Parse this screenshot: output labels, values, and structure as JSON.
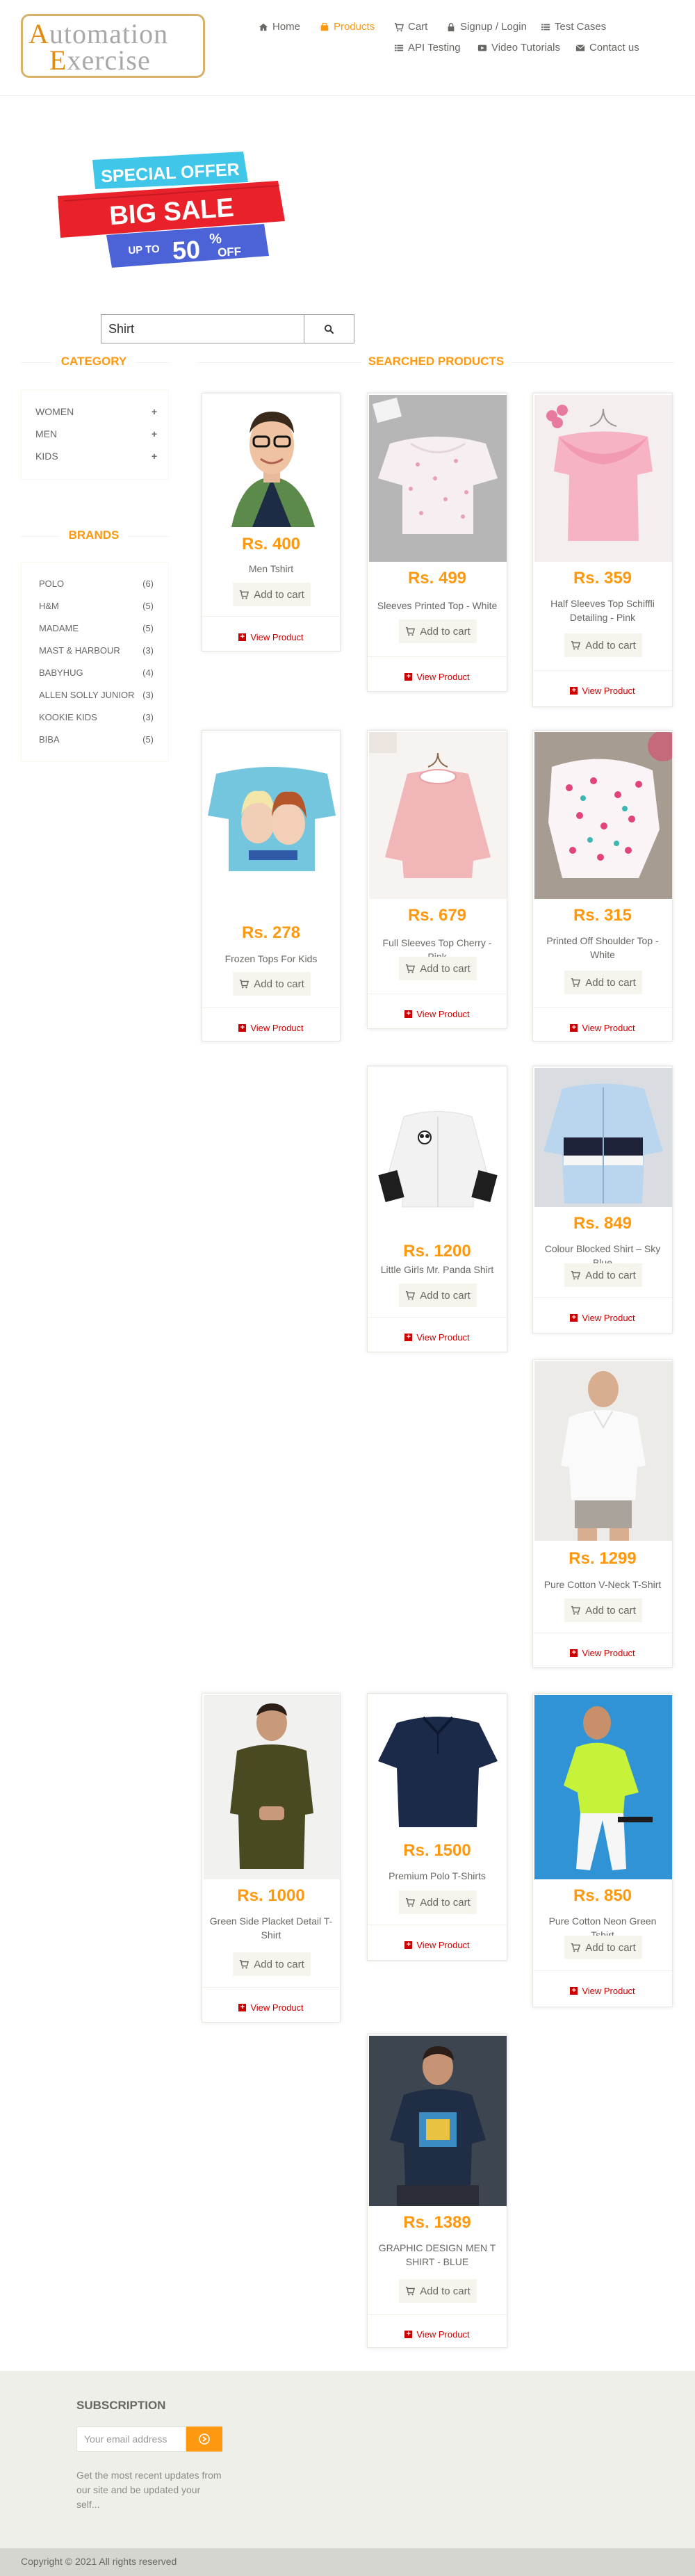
{
  "logo": {
    "line1_cap": "A",
    "line1_rest": "utomation",
    "line2_cap": "E",
    "line2_rest": "xercise"
  },
  "nav": [
    {
      "label": "Home",
      "icon": "home-icon"
    },
    {
      "label": "Products",
      "icon": "products-icon",
      "active": true
    },
    {
      "label": "Cart",
      "icon": "cart-icon"
    },
    {
      "label": "Signup / Login",
      "icon": "lock-icon"
    },
    {
      "label": "Test Cases",
      "icon": "list-icon"
    },
    {
      "label": "API Testing",
      "icon": "list-icon"
    },
    {
      "label": "Video Tutorials",
      "icon": "youtube-icon"
    },
    {
      "label": "Contact us",
      "icon": "envelope-icon"
    }
  ],
  "banner": {
    "special": "SPECIAL OFFER",
    "big_sale": "BIG SALE",
    "up_to": "UP TO",
    "percent": "50",
    "percent_sign": "%",
    "off": "OFF"
  },
  "search": {
    "value": "Shirt"
  },
  "category": {
    "title": "CATEGORY",
    "items": [
      {
        "label": "WOMEN"
      },
      {
        "label": "MEN"
      },
      {
        "label": "KIDS"
      }
    ]
  },
  "brands": {
    "title": "BRANDS",
    "items": [
      {
        "name": "POLO",
        "count": "(6)"
      },
      {
        "name": "H&M",
        "count": "(5)"
      },
      {
        "name": "MADAME",
        "count": "(5)"
      },
      {
        "name": "MAST & HARBOUR",
        "count": "(3)"
      },
      {
        "name": "BABYHUG",
        "count": "(4)"
      },
      {
        "name": "ALLEN SOLLY JUNIOR",
        "count": "(3)"
      },
      {
        "name": "KOOKIE KIDS",
        "count": "(3)"
      },
      {
        "name": "BIBA",
        "count": "(5)"
      }
    ]
  },
  "products": {
    "title": "SEARCHED PRODUCTS",
    "add_to_cart": "Add to cart",
    "view_product": "View Product",
    "items": [
      {
        "price": "Rs. 400",
        "name": "Men Tshirt"
      },
      {
        "price": "Rs. 499",
        "name": "Sleeves Printed Top - White"
      },
      {
        "price": "Rs. 359",
        "name": "Half Sleeves Top Schiffli Detailing - Pink"
      },
      {
        "price": "Rs. 278",
        "name": "Frozen Tops For Kids"
      },
      {
        "price": "Rs. 679",
        "name": "Full Sleeves Top Cherry - Pink"
      },
      {
        "price": "Rs. 315",
        "name": "Printed Off Shoulder Top - White"
      },
      {
        "price": "Rs. 1200",
        "name": "Little Girls Mr. Panda Shirt"
      },
      {
        "price": "Rs. 849",
        "name": "Colour Blocked Shirt – Sky Blue"
      },
      {
        "price": "Rs. 1299",
        "name": "Pure Cotton V-Neck T-Shirt"
      },
      {
        "price": "Rs. 1000",
        "name": "Green Side Placket Detail T-Shirt"
      },
      {
        "price": "Rs. 1500",
        "name": "Premium Polo T-Shirts"
      },
      {
        "price": "Rs. 850",
        "name": "Pure Cotton Neon Green Tshirt"
      },
      {
        "price": "Rs. 1389",
        "name": "GRAPHIC DESIGN MEN T SHIRT - BLUE"
      }
    ]
  },
  "footer": {
    "subscription_title": "SUBSCRIPTION",
    "email_placeholder": "Your email address",
    "note": "Get the most recent updates from our site and be updated your self...",
    "copyright": "Copyright © 2021 All rights reserved"
  },
  "colors": {
    "accent": "#fe980f",
    "link_red": "#cc0000",
    "footer_bg": "#efefe9",
    "footer_bottom": "#d6d6d0"
  }
}
